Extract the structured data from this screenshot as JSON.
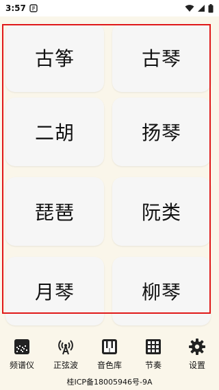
{
  "status_bar": {
    "time": "3:57",
    "icons": [
      "notification-icon",
      "wifi-icon",
      "signal-icon",
      "battery-icon"
    ]
  },
  "instruments": [
    {
      "label": "古筝"
    },
    {
      "label": "古琴"
    },
    {
      "label": "二胡"
    },
    {
      "label": "扬琴"
    },
    {
      "label": "琵琶"
    },
    {
      "label": "阮类"
    },
    {
      "label": "月琴"
    },
    {
      "label": "柳琴"
    }
  ],
  "highlight_color": "#e01818",
  "bottom_nav": [
    {
      "label": "频谱仪",
      "icon": "spectrum-icon"
    },
    {
      "label": "正弦波",
      "icon": "antenna-icon"
    },
    {
      "label": "音色库",
      "icon": "piano-icon"
    },
    {
      "label": "节奏",
      "icon": "grid-icon"
    },
    {
      "label": "设置",
      "icon": "gear-icon"
    }
  ],
  "footer": {
    "icp": "桂ICP备18005946号-9A"
  }
}
